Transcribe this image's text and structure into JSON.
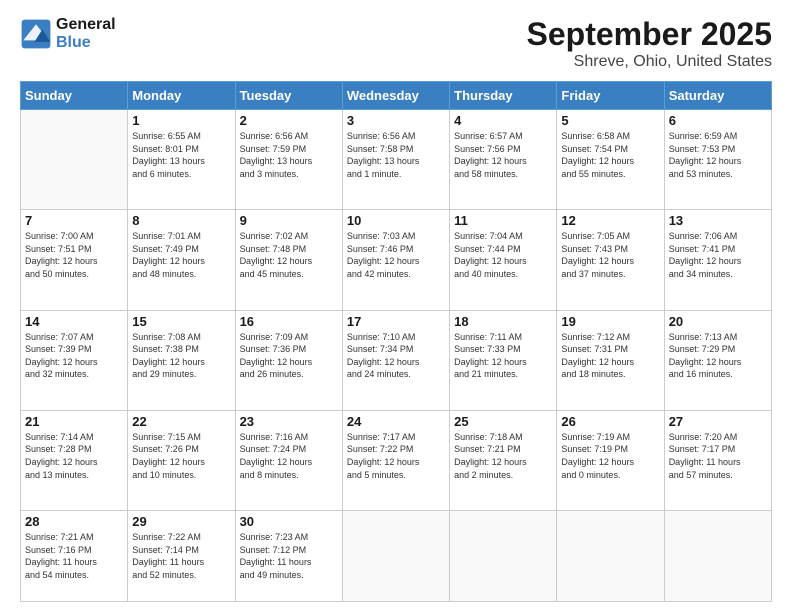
{
  "logo": {
    "line1": "General",
    "line2": "Blue"
  },
  "title": "September 2025",
  "subtitle": "Shreve, Ohio, United States",
  "days_header": [
    "Sunday",
    "Monday",
    "Tuesday",
    "Wednesday",
    "Thursday",
    "Friday",
    "Saturday"
  ],
  "weeks": [
    [
      {
        "num": "",
        "info": ""
      },
      {
        "num": "1",
        "info": "Sunrise: 6:55 AM\nSunset: 8:01 PM\nDaylight: 13 hours\nand 6 minutes."
      },
      {
        "num": "2",
        "info": "Sunrise: 6:56 AM\nSunset: 7:59 PM\nDaylight: 13 hours\nand 3 minutes."
      },
      {
        "num": "3",
        "info": "Sunrise: 6:56 AM\nSunset: 7:58 PM\nDaylight: 13 hours\nand 1 minute."
      },
      {
        "num": "4",
        "info": "Sunrise: 6:57 AM\nSunset: 7:56 PM\nDaylight: 12 hours\nand 58 minutes."
      },
      {
        "num": "5",
        "info": "Sunrise: 6:58 AM\nSunset: 7:54 PM\nDaylight: 12 hours\nand 55 minutes."
      },
      {
        "num": "6",
        "info": "Sunrise: 6:59 AM\nSunset: 7:53 PM\nDaylight: 12 hours\nand 53 minutes."
      }
    ],
    [
      {
        "num": "7",
        "info": "Sunrise: 7:00 AM\nSunset: 7:51 PM\nDaylight: 12 hours\nand 50 minutes."
      },
      {
        "num": "8",
        "info": "Sunrise: 7:01 AM\nSunset: 7:49 PM\nDaylight: 12 hours\nand 48 minutes."
      },
      {
        "num": "9",
        "info": "Sunrise: 7:02 AM\nSunset: 7:48 PM\nDaylight: 12 hours\nand 45 minutes."
      },
      {
        "num": "10",
        "info": "Sunrise: 7:03 AM\nSunset: 7:46 PM\nDaylight: 12 hours\nand 42 minutes."
      },
      {
        "num": "11",
        "info": "Sunrise: 7:04 AM\nSunset: 7:44 PM\nDaylight: 12 hours\nand 40 minutes."
      },
      {
        "num": "12",
        "info": "Sunrise: 7:05 AM\nSunset: 7:43 PM\nDaylight: 12 hours\nand 37 minutes."
      },
      {
        "num": "13",
        "info": "Sunrise: 7:06 AM\nSunset: 7:41 PM\nDaylight: 12 hours\nand 34 minutes."
      }
    ],
    [
      {
        "num": "14",
        "info": "Sunrise: 7:07 AM\nSunset: 7:39 PM\nDaylight: 12 hours\nand 32 minutes."
      },
      {
        "num": "15",
        "info": "Sunrise: 7:08 AM\nSunset: 7:38 PM\nDaylight: 12 hours\nand 29 minutes."
      },
      {
        "num": "16",
        "info": "Sunrise: 7:09 AM\nSunset: 7:36 PM\nDaylight: 12 hours\nand 26 minutes."
      },
      {
        "num": "17",
        "info": "Sunrise: 7:10 AM\nSunset: 7:34 PM\nDaylight: 12 hours\nand 24 minutes."
      },
      {
        "num": "18",
        "info": "Sunrise: 7:11 AM\nSunset: 7:33 PM\nDaylight: 12 hours\nand 21 minutes."
      },
      {
        "num": "19",
        "info": "Sunrise: 7:12 AM\nSunset: 7:31 PM\nDaylight: 12 hours\nand 18 minutes."
      },
      {
        "num": "20",
        "info": "Sunrise: 7:13 AM\nSunset: 7:29 PM\nDaylight: 12 hours\nand 16 minutes."
      }
    ],
    [
      {
        "num": "21",
        "info": "Sunrise: 7:14 AM\nSunset: 7:28 PM\nDaylight: 12 hours\nand 13 minutes."
      },
      {
        "num": "22",
        "info": "Sunrise: 7:15 AM\nSunset: 7:26 PM\nDaylight: 12 hours\nand 10 minutes."
      },
      {
        "num": "23",
        "info": "Sunrise: 7:16 AM\nSunset: 7:24 PM\nDaylight: 12 hours\nand 8 minutes."
      },
      {
        "num": "24",
        "info": "Sunrise: 7:17 AM\nSunset: 7:22 PM\nDaylight: 12 hours\nand 5 minutes."
      },
      {
        "num": "25",
        "info": "Sunrise: 7:18 AM\nSunset: 7:21 PM\nDaylight: 12 hours\nand 2 minutes."
      },
      {
        "num": "26",
        "info": "Sunrise: 7:19 AM\nSunset: 7:19 PM\nDaylight: 12 hours\nand 0 minutes."
      },
      {
        "num": "27",
        "info": "Sunrise: 7:20 AM\nSunset: 7:17 PM\nDaylight: 11 hours\nand 57 minutes."
      }
    ],
    [
      {
        "num": "28",
        "info": "Sunrise: 7:21 AM\nSunset: 7:16 PM\nDaylight: 11 hours\nand 54 minutes."
      },
      {
        "num": "29",
        "info": "Sunrise: 7:22 AM\nSunset: 7:14 PM\nDaylight: 11 hours\nand 52 minutes."
      },
      {
        "num": "30",
        "info": "Sunrise: 7:23 AM\nSunset: 7:12 PM\nDaylight: 11 hours\nand 49 minutes."
      },
      {
        "num": "",
        "info": ""
      },
      {
        "num": "",
        "info": ""
      },
      {
        "num": "",
        "info": ""
      },
      {
        "num": "",
        "info": ""
      }
    ]
  ]
}
